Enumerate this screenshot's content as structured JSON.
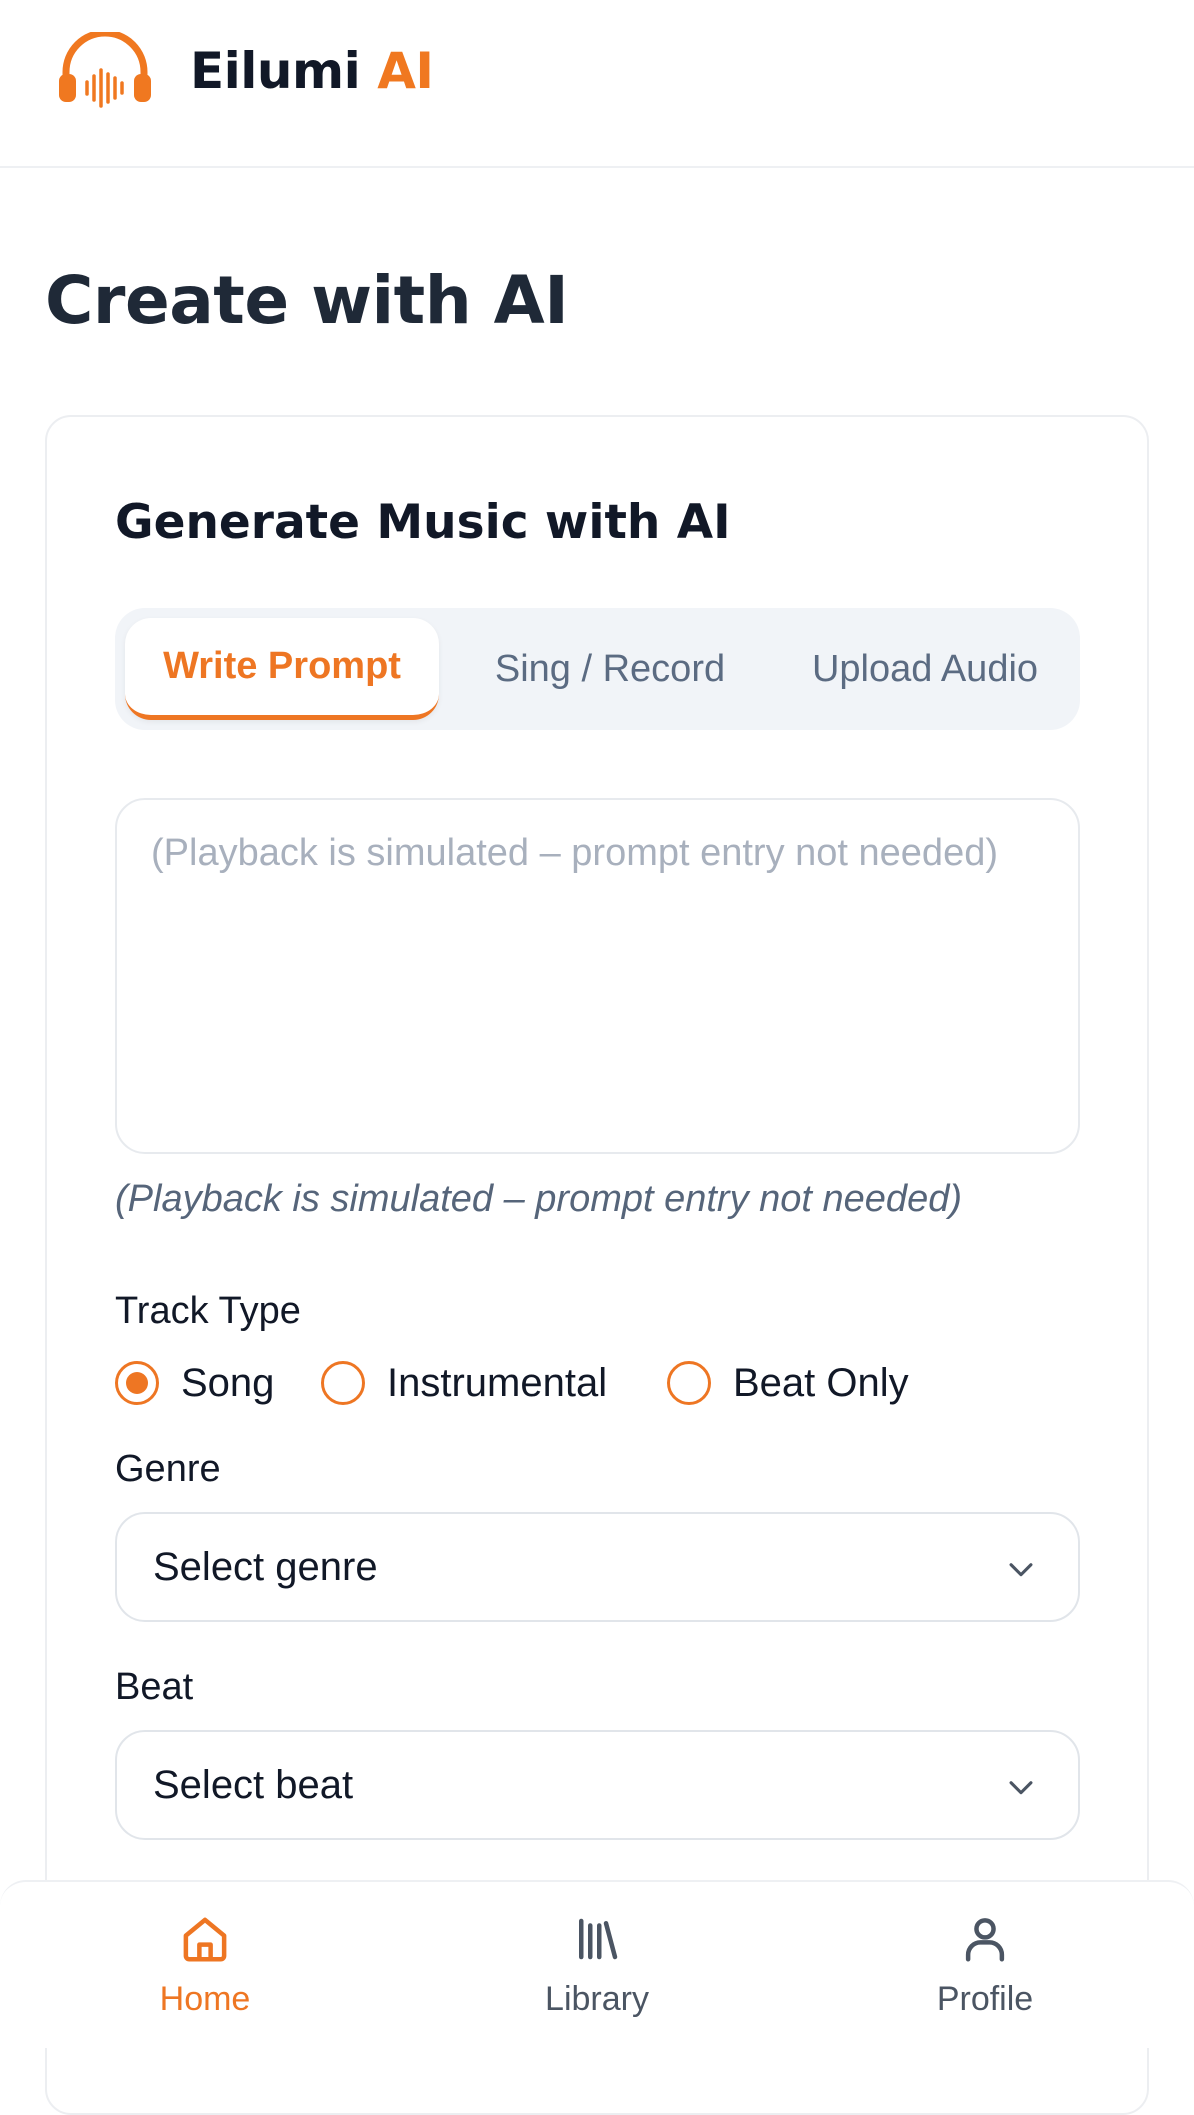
{
  "header": {
    "brand_primary": "Eilumi",
    "brand_accent": "AI",
    "logo_icon": "headphones-waveform-icon"
  },
  "page": {
    "title": "Create with AI"
  },
  "card": {
    "title": "Generate Music with AI",
    "tabs": [
      {
        "label": "Write Prompt",
        "active": true
      },
      {
        "label": "Sing / Record",
        "active": false
      },
      {
        "label": "Upload Audio",
        "active": false
      }
    ],
    "prompt": {
      "value": "",
      "placeholder": "(Playback is simulated – prompt entry not needed)"
    },
    "hint": "(Playback is simulated – prompt entry not needed)",
    "track_type": {
      "label": "Track Type",
      "options": [
        {
          "label": "Song",
          "checked": true
        },
        {
          "label": "Instrumental",
          "checked": false
        },
        {
          "label": "Beat Only",
          "checked": false
        }
      ]
    },
    "genre": {
      "label": "Genre",
      "value": "Select genre"
    },
    "beat": {
      "label": "Beat",
      "value": "Select beat"
    }
  },
  "bottom_nav": {
    "items": [
      {
        "label": "Home",
        "icon": "home-icon",
        "active": true
      },
      {
        "label": "Library",
        "icon": "library-icon",
        "active": false
      },
      {
        "label": "Profile",
        "icon": "user-icon",
        "active": false
      }
    ]
  },
  "colors": {
    "accent": "#ee7623",
    "text": "#111827",
    "muted": "#5b6b82",
    "placeholder": "#a8b0bd"
  }
}
